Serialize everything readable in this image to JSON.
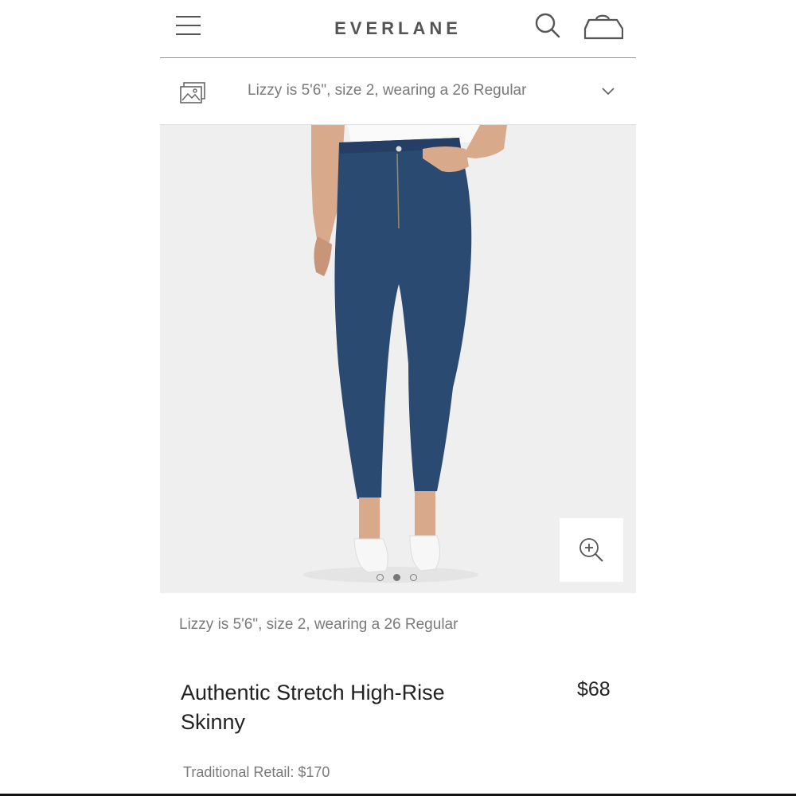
{
  "header": {
    "logo": "EVERLANE",
    "menu_icon": "hamburger-menu-icon",
    "search_icon": "search-icon",
    "cart_icon": "shopping-bag-icon"
  },
  "model_bar": {
    "icon": "image-gallery-icon",
    "text": "Lizzy is 5'6\", size 2, wearing a 26 Regular",
    "toggle_icon": "chevron-down-icon"
  },
  "gallery": {
    "zoom_icon": "zoom-in-icon",
    "image_count": 3,
    "active_index": 1
  },
  "caption": "Lizzy is 5'6\", size 2, wearing a 26 Regular",
  "product": {
    "title": "Authentic Stretch High-Rise Skinny",
    "price": "$68",
    "traditional_retail": "Traditional Retail: $170"
  },
  "colors": {
    "denim": "#2b4a72",
    "background": "#efefef",
    "text_gray": "#7a7a7a"
  }
}
